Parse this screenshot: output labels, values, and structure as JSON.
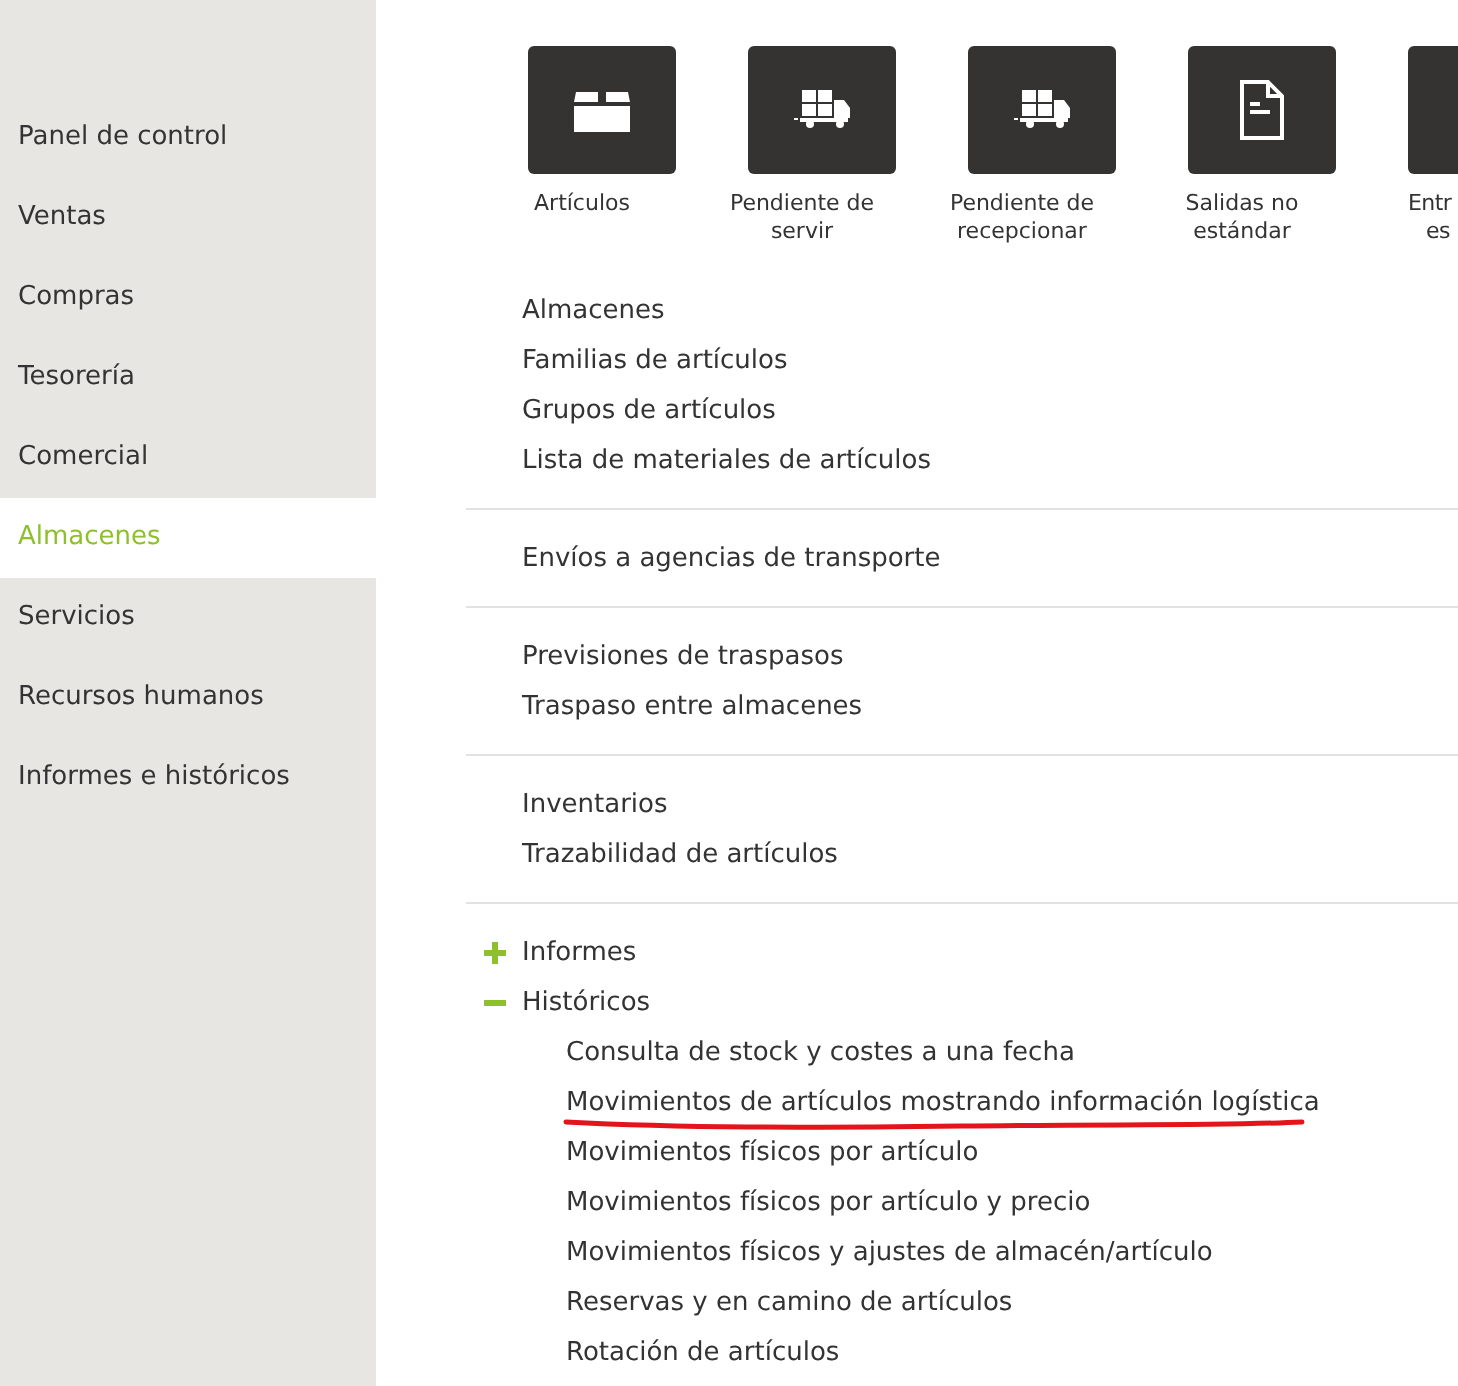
{
  "sidebar": {
    "items": [
      {
        "label": "Panel de control",
        "selected": false
      },
      {
        "label": "Ventas",
        "selected": false
      },
      {
        "label": "Compras",
        "selected": false
      },
      {
        "label": "Tesorería",
        "selected": false
      },
      {
        "label": "Comercial",
        "selected": false
      },
      {
        "label": "Almacenes",
        "selected": true
      },
      {
        "label": "Servicios",
        "selected": false
      },
      {
        "label": "Recursos humanos",
        "selected": false
      },
      {
        "label": "Informes e históricos",
        "selected": false
      }
    ]
  },
  "tiles": [
    {
      "kind": "box",
      "label": [
        "Artículos"
      ]
    },
    {
      "kind": "truck",
      "label": [
        "Pendiente de",
        "servir"
      ]
    },
    {
      "kind": "truck",
      "label": [
        "Pendiente de",
        "recepcionar"
      ]
    },
    {
      "kind": "document",
      "label": [
        "Salidas no",
        "estándar"
      ]
    },
    {
      "kind": "cut",
      "label": [
        "Entr",
        "es"
      ]
    }
  ],
  "link_groups": [
    [
      "Almacenes",
      "Familias de artículos",
      "Grupos de artículos",
      "Lista de materiales de artículos"
    ],
    [
      "Envíos a agencias de transporte"
    ],
    [
      "Previsiones de traspasos",
      "Traspaso entre almacenes"
    ],
    [
      "Inventarios",
      "Trazabilidad de artículos"
    ]
  ],
  "tree": [
    {
      "label": "Informes",
      "expanded": false
    },
    {
      "label": "Históricos",
      "expanded": true,
      "children": [
        {
          "label": "Consulta de stock y costes a una fecha",
          "underlined": false
        },
        {
          "label": "Movimientos de artículos mostrando información logística",
          "underlined": true
        },
        {
          "label": "Movimientos físicos por artículo",
          "underlined": false
        },
        {
          "label": "Movimientos físicos por artículo y precio",
          "underlined": false
        },
        {
          "label": "Movimientos físicos y ajustes de almacén/artículo",
          "underlined": false
        },
        {
          "label": "Reservas y en camino de artículos",
          "underlined": false
        },
        {
          "label": "Rotación de artículos",
          "underlined": false
        }
      ]
    }
  ]
}
